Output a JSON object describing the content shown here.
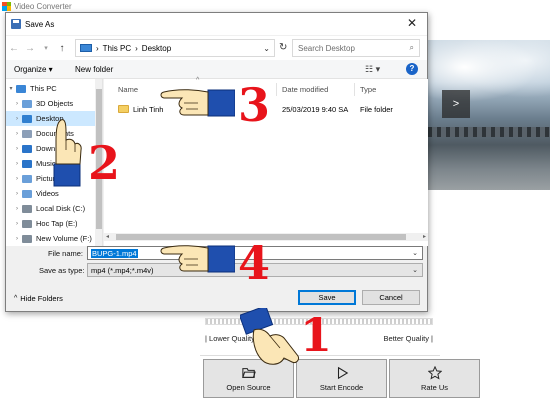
{
  "app": {
    "title": "Video Converter",
    "logo_colors": [
      "#f25022",
      "#7fba00",
      "#00a4ef",
      "#ffb900"
    ],
    "next_label": ">",
    "quality_low": "| Lower Quality",
    "quality_high": "Better Quality |",
    "bottom_buttons": [
      {
        "label": "Open Source",
        "icon": "folder-open-icon"
      },
      {
        "label": "Start Encode",
        "icon": "play-icon"
      },
      {
        "label": "Rate Us",
        "icon": "star-icon"
      }
    ]
  },
  "dialog": {
    "title": "Save As",
    "close_label": "✕",
    "breadcrumb": [
      "This PC",
      "Desktop"
    ],
    "breadcrumb_sep": "›",
    "search_placeholder": "Search Desktop",
    "organize_label": "Organize ▾",
    "new_folder_label": "New folder",
    "view_label": "☷ ▾",
    "help_label": "?",
    "nav_items": [
      {
        "label": "This PC",
        "icon": "computer-icon",
        "caret": "▾",
        "color": "#3a86d6"
      },
      {
        "label": "3D Objects",
        "icon": "cube-icon",
        "caret": "›",
        "color": "#6a9fd9"
      },
      {
        "label": "Desktop",
        "icon": "desktop-icon",
        "caret": "›",
        "color": "#2f7fd0",
        "selected": true
      },
      {
        "label": "Documents",
        "icon": "document-icon",
        "caret": "›",
        "color": "#8c9fb8"
      },
      {
        "label": "Downloads",
        "icon": "download-icon",
        "caret": "›",
        "color": "#2a74c9"
      },
      {
        "label": "Music",
        "icon": "music-icon",
        "caret": "›",
        "color": "#2a74c9"
      },
      {
        "label": "Pictures",
        "icon": "pictures-icon",
        "caret": "›",
        "color": "#6a9fd9"
      },
      {
        "label": "Videos",
        "icon": "video-icon",
        "caret": "›",
        "color": "#6a9fd9"
      },
      {
        "label": "Local Disk (C:)",
        "icon": "disk-icon",
        "caret": "›",
        "color": "#7f8c99"
      },
      {
        "label": "Hoc Tap (E:)",
        "icon": "disk-icon",
        "caret": "›",
        "color": "#7f8c99"
      },
      {
        "label": "New Volume (F:)",
        "icon": "disk-icon",
        "caret": "›",
        "color": "#7f8c99"
      }
    ],
    "columns": [
      "Name",
      "Date modified",
      "Type"
    ],
    "files": [
      {
        "name": "Linh Tinh",
        "date": "25/03/2019 9:40 SA",
        "type": "File folder"
      }
    ],
    "filename_label": "File name:",
    "filename_value": "BUPG-1.mp4",
    "savetype_label": "Save as type:",
    "savetype_value": "mp4 (*.mp4;*.m4v)",
    "hide_folders_label": "Hide Folders",
    "save_label": "Save",
    "cancel_label": "Cancel"
  },
  "annotations": {
    "steps": [
      "1",
      "2",
      "3",
      "4"
    ],
    "step_color": "#e8141b"
  }
}
